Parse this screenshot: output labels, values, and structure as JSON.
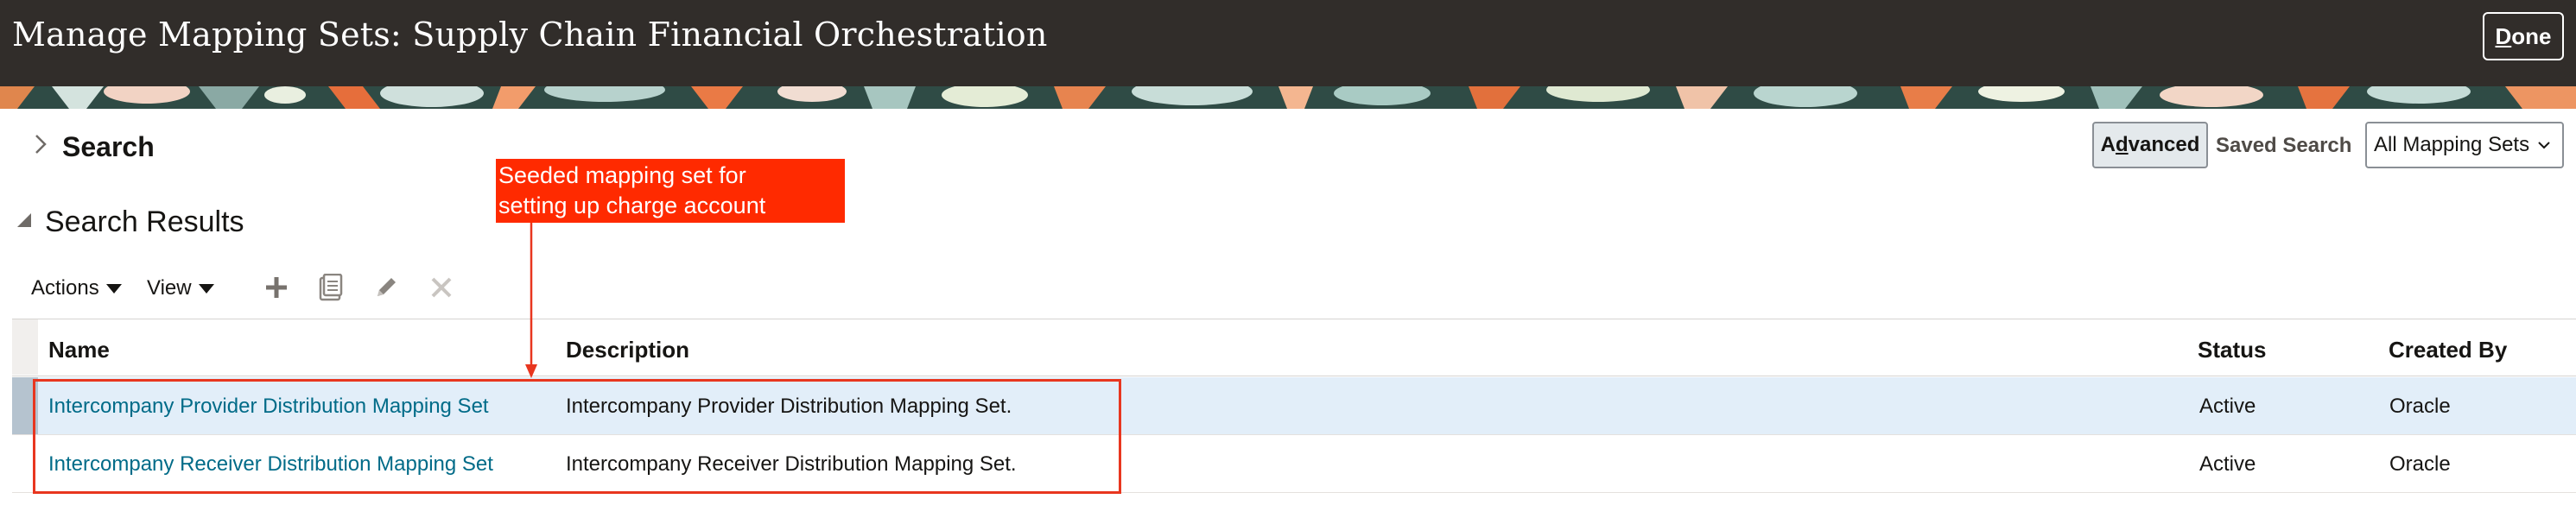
{
  "header": {
    "title": "Manage Mapping Sets: Supply Chain Financial Orchestration",
    "done_label_underlined": "D",
    "done_label_rest": "one"
  },
  "search": {
    "title": "Search",
    "advanced_pre": "A",
    "advanced_underlined": "d",
    "advanced_post": "vanced",
    "saved_search_label": "Saved Search",
    "saved_search_value": "All Mapping Sets"
  },
  "results": {
    "title": "Search Results",
    "toolbar": {
      "actions_label": "Actions",
      "view_label": "View",
      "icons": [
        "add-icon",
        "duplicate-icon",
        "edit-icon",
        "delete-icon"
      ]
    },
    "columns": {
      "name": "Name",
      "description": "Description",
      "status": "Status",
      "created_by": "Created By"
    },
    "rows": [
      {
        "name": "Intercompany Provider Distribution Mapping Set",
        "description": "Intercompany Provider Distribution Mapping Set.",
        "status": "Active",
        "created_by": "Oracle"
      },
      {
        "name": "Intercompany Receiver Distribution Mapping Set",
        "description": "Intercompany Receiver Distribution Mapping Set.",
        "status": "Active",
        "created_by": "Oracle"
      }
    ]
  },
  "annotation": {
    "line1": "Seeded mapping set for",
    "line2": "setting up charge account",
    "color": "#ff2a00"
  },
  "colors": {
    "header_bg": "#312d2a",
    "link": "#006b88",
    "selected_row": "#e2eef9"
  }
}
